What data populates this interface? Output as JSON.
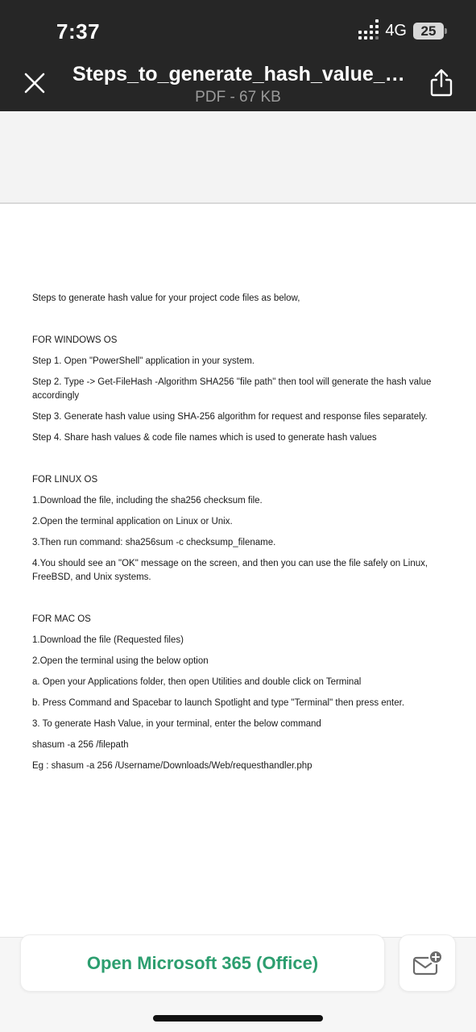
{
  "status": {
    "time": "7:37",
    "network": "4G",
    "battery": "25"
  },
  "header": {
    "title": "Steps_to_generate_hash_value_for...",
    "meta": "PDF - 67 KB"
  },
  "document": {
    "intro": "Steps to generate hash value for your project code files as below,",
    "windows": {
      "heading": "FOR WINDOWS OS",
      "steps": [
        "Step 1. Open \"PowerShell\" application in your system.",
        "Step 2. Type -> Get-FileHash -Algorithm SHA256 \"file path\" then tool will generate the hash value accordingly",
        "Step 3. Generate hash value using SHA-256 algorithm for request and response files separately.",
        "Step 4. Share hash values & code file names which is used to generate hash values"
      ]
    },
    "linux": {
      "heading": "FOR LINUX OS",
      "steps": [
        "1.Download the file, including the sha256 checksum file.",
        "2.Open the terminal application on Linux or Unix.",
        "3.Then run command: sha256sum -c checksump_filename.",
        "4.You should see an \"OK\" message on the screen, and then you can use the file safely on Linux, FreeBSD, and Unix systems."
      ]
    },
    "mac": {
      "heading": "FOR MAC OS",
      "steps": [
        "1.Download the file (Requested files)",
        "2.Open the terminal using the below option",
        "a. Open your Applications folder, then open Utilities and double click on Terminal",
        "b. Press Command and Spacebar to launch Spotlight and type \"Terminal\" then press enter.",
        "3. To generate Hash Value, in your terminal, enter the below command",
        "shasum -a 256 /filepath",
        "Eg : shasum -a 256 /Username/Downloads/Web/requesthandler.php"
      ]
    }
  },
  "actions": {
    "open_label": "Open Microsoft 365 (Office)"
  },
  "icons": {
    "close": "close-icon",
    "share": "share-icon",
    "mail": "mail-add-icon",
    "signal": "signal-icon"
  },
  "colors": {
    "header_bg": "#262626",
    "accent_green": "#2c9e6f"
  }
}
